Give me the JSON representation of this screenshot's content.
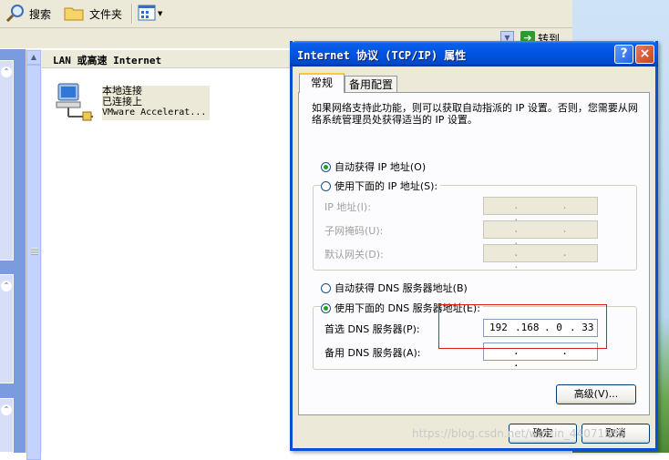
{
  "explorer": {
    "toolbar": {
      "search_label": "搜索",
      "folders_label": "文件夹"
    },
    "address": {
      "go_label": "转到"
    },
    "list": {
      "section_header": "LAN 或高速 Internet",
      "connection": {
        "name": "本地连接",
        "status": "已连接上",
        "device": "VMware Accelerat..."
      }
    }
  },
  "dialog": {
    "title": "Internet 协议 (TCP/IP) 属性",
    "help_icon": "?",
    "close_icon": "×",
    "tabs": [
      {
        "label": "常规"
      },
      {
        "label": "备用配置"
      }
    ],
    "description": "如果网络支持此功能，则可以获取自动指派的 IP 设置。否则，您需要从网络系统管理员处获得适当的 IP 设置。",
    "ip": {
      "auto_label": "自动获得 IP 地址(O)",
      "auto_selected": true,
      "manual_label": "使用下面的 IP 地址(S):",
      "address_label": "IP 地址(I):",
      "address_value": ". . .",
      "subnet_label": "子网掩码(U):",
      "subnet_value": ". . .",
      "gateway_label": "默认网关(D):",
      "gateway_value": ". . ."
    },
    "dns": {
      "auto_label": "自动获得 DNS 服务器地址(B)",
      "manual_label": "使用下面的 DNS 服务器地址(E):",
      "manual_selected": true,
      "preferred_label": "首选 DNS 服务器(P):",
      "preferred_octets": [
        "192",
        ".168",
        ".  0",
        ". 33"
      ],
      "alternate_label": "备用 DNS 服务器(A):",
      "alternate_value": ". . ."
    },
    "advanced_label": "高级(V)...",
    "ok_label": "确定",
    "cancel_label": "取消"
  },
  "watermark": "https://blog.csdn.net/weixin_44071535"
}
